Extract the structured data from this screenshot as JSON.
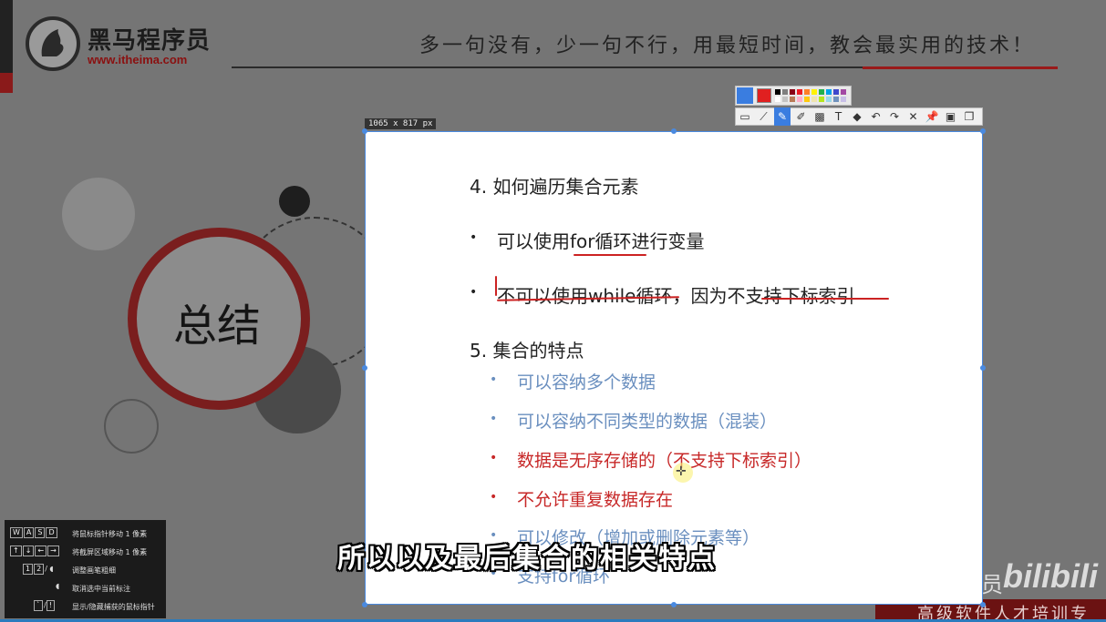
{
  "brand": {
    "name_cn": "黑马程序员",
    "url": "www.itheima.com"
  },
  "slogan": "多一句没有，少一句不行，用最短时间，教会最实用的技术！",
  "summary_title": "总结",
  "capture": {
    "size_label": "1065 x 817  px",
    "heading1": "4. 如何遍历集合元素",
    "item1": "可以使用for循环进行变量",
    "item2": "不可以使用while循环，因为不支持下标索引",
    "heading2": "5. 集合的特点",
    "features": [
      {
        "text": "可以容纳多个数据",
        "color": "#6a8fbf"
      },
      {
        "text": "可以容纳不同类型的数据（混装）",
        "color": "#6a8fbf"
      },
      {
        "text": "数据是无序存储的（不支持下标索引）",
        "color": "#c72828"
      },
      {
        "text": "不允许重复数据存在",
        "color": "#c72828"
      },
      {
        "text": "可以修改（增加或删除元素等）",
        "color": "#6a8fbf"
      },
      {
        "text": "支持for循环",
        "color": "#6a8fbf"
      }
    ]
  },
  "toolbar": {
    "active_color": "#e02020",
    "palette": [
      "#000000",
      "#7f7f7f",
      "#880015",
      "#ed1c24",
      "#ff7f27",
      "#fff200",
      "#22b14c",
      "#00a2e8",
      "#3f48cc",
      "#a349a4",
      "#ffffff",
      "#c3c3c3",
      "#b97a57",
      "#ffaec9",
      "#ffc90e",
      "#efe4b0",
      "#b5e61d",
      "#99d9ea",
      "#7092be",
      "#c8bfe7"
    ],
    "tools": [
      {
        "name": "rectangle-tool",
        "glyph": "▭"
      },
      {
        "name": "line-tool",
        "glyph": "⟋"
      },
      {
        "name": "pen-tool",
        "glyph": "✎",
        "active": true
      },
      {
        "name": "marker-tool",
        "glyph": "✐"
      },
      {
        "name": "mosaic-tool",
        "glyph": "▩"
      },
      {
        "name": "text-tool",
        "glyph": "T"
      },
      {
        "name": "eraser-tool",
        "glyph": "◆"
      },
      {
        "name": "undo-tool",
        "glyph": "↶"
      },
      {
        "name": "redo-tool",
        "glyph": "↷"
      },
      {
        "name": "cancel-tool",
        "glyph": "✕"
      },
      {
        "name": "pin-tool",
        "glyph": "📌"
      },
      {
        "name": "save-tool",
        "glyph": "▣"
      },
      {
        "name": "copy-tool",
        "glyph": "❐"
      }
    ]
  },
  "shortcuts": {
    "row1_keys": [
      "W",
      "A",
      "S",
      "D"
    ],
    "row1_text": "将鼠标指针移动 1 像素",
    "row2_keys": [
      "↑",
      "↓",
      "←",
      "→"
    ],
    "row2_text": "将截屏区域移动 1 像素",
    "row3_keys": [
      "1",
      "2"
    ],
    "row3_text": "调整画笔粗细",
    "row4_text": "取消选中当前标注",
    "row5_keys": [
      "`",
      "!"
    ],
    "row5_text": "显示/隐藏捕获的鼠标指针"
  },
  "subtitle": "所以以及最后集合的相关特点",
  "watermark": {
    "bili": "bilibili",
    "pre": "员"
  },
  "footer_text": "高级软件人才培训专家"
}
